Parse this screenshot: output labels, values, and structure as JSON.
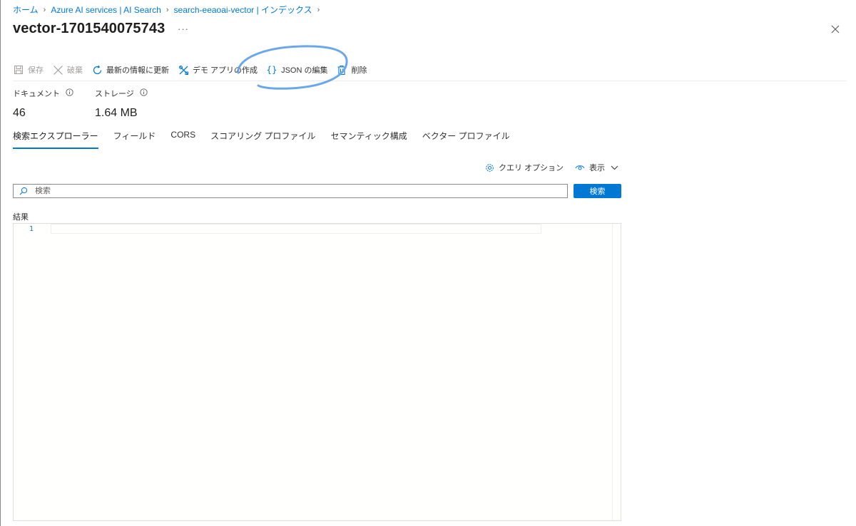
{
  "breadcrumb": [
    {
      "label": "ホーム"
    },
    {
      "label": "Azure AI services | AI Search"
    },
    {
      "label": "search-eeaoai-vector | インデックス"
    }
  ],
  "header": {
    "title": "vector-1701540075743",
    "more": "···"
  },
  "toolbar": {
    "save": "保存",
    "discard": "破棄",
    "refresh": "最新の情報に更新",
    "demo_app": "デモ アプリの作成",
    "edit_json": "JSON の編集",
    "delete": "削除"
  },
  "stats": {
    "documents_label": "ドキュメント",
    "documents_value": "46",
    "storage_label": "ストレージ",
    "storage_value": "1.64 MB"
  },
  "tabs": [
    {
      "label": "検索エクスプローラー",
      "active": true
    },
    {
      "label": "フィールド",
      "active": false
    },
    {
      "label": "CORS",
      "active": false
    },
    {
      "label": "スコアリング プロファイル",
      "active": false
    },
    {
      "label": "セマンティック構成",
      "active": false
    },
    {
      "label": "ベクター プロファイル",
      "active": false
    }
  ],
  "options": {
    "query_options": "クエリ オプション",
    "view": "表示"
  },
  "search": {
    "placeholder": "検索",
    "value": "",
    "button": "検索"
  },
  "results": {
    "label": "結果",
    "line_number": "1"
  },
  "colors": {
    "accent": "#0078d4",
    "highlight_circle": "#6aa8ea"
  }
}
